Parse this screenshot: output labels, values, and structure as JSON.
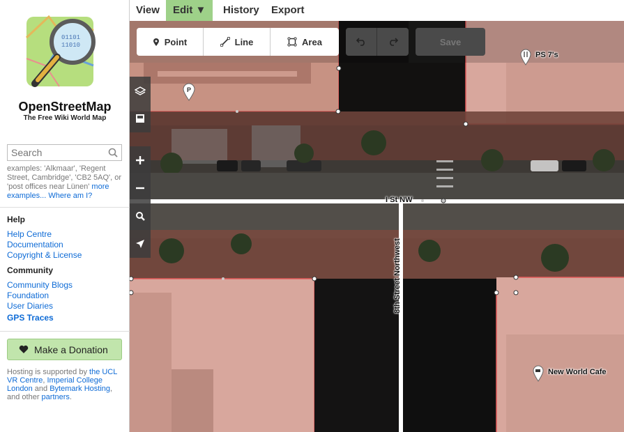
{
  "sidebar": {
    "brand": "OpenStreetMap",
    "tagline": "The Free Wiki World Map",
    "search_placeholder": "Search",
    "examples_prefix": "examples: 'Alkmaar', 'Regent Street, Cambridge', 'CB2 5AQ', or 'post offices near Lünen'",
    "examples_more": "more examples...",
    "examples_where": "Where am I?",
    "help_heading": "Help",
    "help_links": [
      "Help Centre",
      "Documentation",
      "Copyright & License"
    ],
    "community_heading": "Community",
    "community_links": [
      "Community Blogs",
      "Foundation",
      "User Diaries",
      "GPS Traces"
    ],
    "donate_label": "Make a Donation",
    "hosting_text_1": "Hosting is supported by",
    "hosting_link_1": "the UCL VR Centre",
    "hosting_sep_1": ",",
    "hosting_link_2": "Imperial College London",
    "hosting_and": "and",
    "hosting_link_3": "Bytemark Hosting",
    "hosting_text_2": ", and other",
    "hosting_link_4": "partners",
    "hosting_end": "."
  },
  "topnav": {
    "view": "View",
    "edit": "Edit ▼",
    "history": "History",
    "export": "Export"
  },
  "toolbar": {
    "point": "Point",
    "line": "Line",
    "area": "Area",
    "save": "Save"
  },
  "map": {
    "street_1": "I St NW",
    "street_2": "8th Street Northwest",
    "poi_1": "PS 7's",
    "poi_2": "New World Cafe",
    "poi_parking": "P"
  },
  "colors": {
    "accent_green": "#9ed189",
    "donate_green": "#c1e5ac",
    "link_blue": "#0e6bd6",
    "building_fill": "#d8a79d"
  }
}
